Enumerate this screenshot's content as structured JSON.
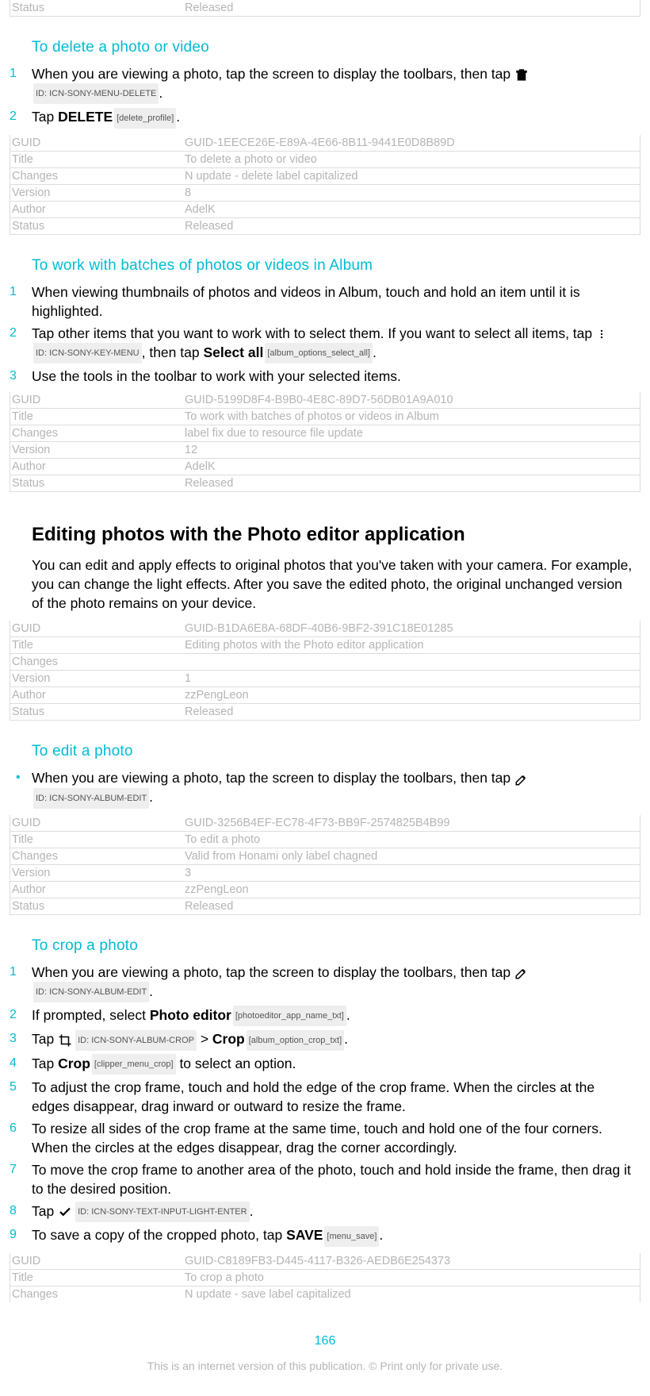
{
  "meta0": {
    "status_k": "Status",
    "status_v": "Released"
  },
  "sec1": {
    "title": "To delete a photo or video",
    "steps": [
      {
        "pre": "When you are viewing a photo, tap the screen to display the toolbars, then tap ",
        "icon": "trash",
        "ref": "ID: ICN-SONY-MENU-DELETE",
        "post": "."
      },
      {
        "pre": "Tap ",
        "label": "DELETE",
        "ref": "[delete_profile]",
        "post": "."
      }
    ]
  },
  "meta1": {
    "guid_k": "GUID",
    "guid_v": "GUID-1EECE26E-E89A-4E66-8B11-9441E0D8B89D",
    "title_k": "Title",
    "title_v": "To delete a photo or video",
    "changes_k": "Changes",
    "changes_v": "N update - delete label capitalized",
    "version_k": "Version",
    "version_v": "8",
    "author_k": "Author",
    "author_v": "AdelK",
    "status_k": "Status",
    "status_v": "Released"
  },
  "sec2": {
    "title": "To work with batches of photos or videos in Album",
    "step1": "When viewing thumbnails of photos and videos in Album, touch and hold an item until it is highlighted.",
    "step2_pre": "Tap other items that you want to work with to select them. If you want to select all items, tap ",
    "step2_ref1": "ID: ICN-SONY-KEY-MENU",
    "step2_mid": ", then tap ",
    "step2_label": "Select all",
    "step2_ref2": "[album_options_select_all]",
    "step2_post": ".",
    "step3": "Use the tools in the toolbar to work with your selected items."
  },
  "meta2": {
    "guid_k": "GUID",
    "guid_v": "GUID-5199D8F4-B9B0-4E8C-89D7-56DB01A9A010",
    "title_k": "Title",
    "title_v": "To work with batches of photos or videos in Album",
    "changes_k": "Changes",
    "changes_v": "label fix due to resource file update",
    "version_k": "Version",
    "version_v": "12",
    "author_k": "Author",
    "author_v": "AdelK",
    "status_k": "Status",
    "status_v": "Released"
  },
  "sec3": {
    "title": "Editing photos with the Photo editor application",
    "para": "You can edit and apply effects to original photos that you've taken with your camera. For example, you can change the light effects. After you save the edited photo, the original unchanged version of the photo remains on your device."
  },
  "meta3": {
    "guid_k": "GUID",
    "guid_v": "GUID-B1DA6E8A-68DF-40B6-9BF2-391C18E01285",
    "title_k": "Title",
    "title_v": "Editing photos with the Photo editor application",
    "changes_k": "Changes",
    "changes_v": "",
    "version_k": "Version",
    "version_v": "1",
    "author_k": "Author",
    "author_v": "zzPengLeon",
    "status_k": "Status",
    "status_v": "Released"
  },
  "sec4": {
    "title": "To edit a photo",
    "b_pre": "When you are viewing a photo, tap the screen to display the toolbars, then tap ",
    "b_ref": "ID: ICN-SONY-ALBUM-EDIT",
    "b_post": "."
  },
  "meta4": {
    "guid_k": "GUID",
    "guid_v": "GUID-3256B4EF-EC78-4F73-BB9F-2574825B4B99",
    "title_k": "Title",
    "title_v": "To edit a photo",
    "changes_k": "Changes",
    "changes_v": "Valid from Honami only label chagned",
    "version_k": "Version",
    "version_v": "3",
    "author_k": "Author",
    "author_v": "zzPengLeon",
    "status_k": "Status",
    "status_v": "Released"
  },
  "sec5": {
    "title": "To crop a photo",
    "s1_pre": "When you are viewing a photo, tap the screen to display the toolbars, then tap ",
    "s1_ref": "ID: ICN-SONY-ALBUM-EDIT",
    "s1_post": ".",
    "s2_pre": "If prompted, select ",
    "s2_label": "Photo editor",
    "s2_ref": "[photoeditor_app_name_txt]",
    "s2_post": ".",
    "s3_pre": "Tap ",
    "s3_ref1": "ID: ICN-SONY-ALBUM-CROP",
    "s3_mid": " > ",
    "s3_label": "Crop",
    "s3_ref2": "[album_option_crop_txt]",
    "s3_post": ".",
    "s4_pre": "Tap ",
    "s4_label": "Crop",
    "s4_ref": "[clipper_menu_crop]",
    "s4_post": " to select an option.",
    "s5": "To adjust the crop frame, touch and hold the edge of the crop frame. When the circles at the edges disappear, drag inward or outward to resize the frame.",
    "s6": "To resize all sides of the crop frame at the same time, touch and hold one of the four corners. When the circles at the edges disappear, drag the corner accordingly.",
    "s7": "To move the crop frame to another area of the photo, touch and hold inside the frame, then drag it to the desired position.",
    "s8_pre": "Tap ",
    "s8_ref": "ID: ICN-SONY-TEXT-INPUT-LIGHT-ENTER",
    "s8_post": ".",
    "s9_pre": "To save a copy of the cropped photo, tap ",
    "s9_label": "SAVE",
    "s9_ref": "[menu_save]",
    "s9_post": "."
  },
  "meta5": {
    "guid_k": "GUID",
    "guid_v": "GUID-C8189FB3-D445-4117-B326-AEDB6E254373",
    "title_k": "Title",
    "title_v": "To crop a photo",
    "changes_k": "Changes",
    "changes_v": "N update - save label capitalized"
  },
  "page_number": "166",
  "footer": "This is an internet version of this publication. © Print only for private use."
}
